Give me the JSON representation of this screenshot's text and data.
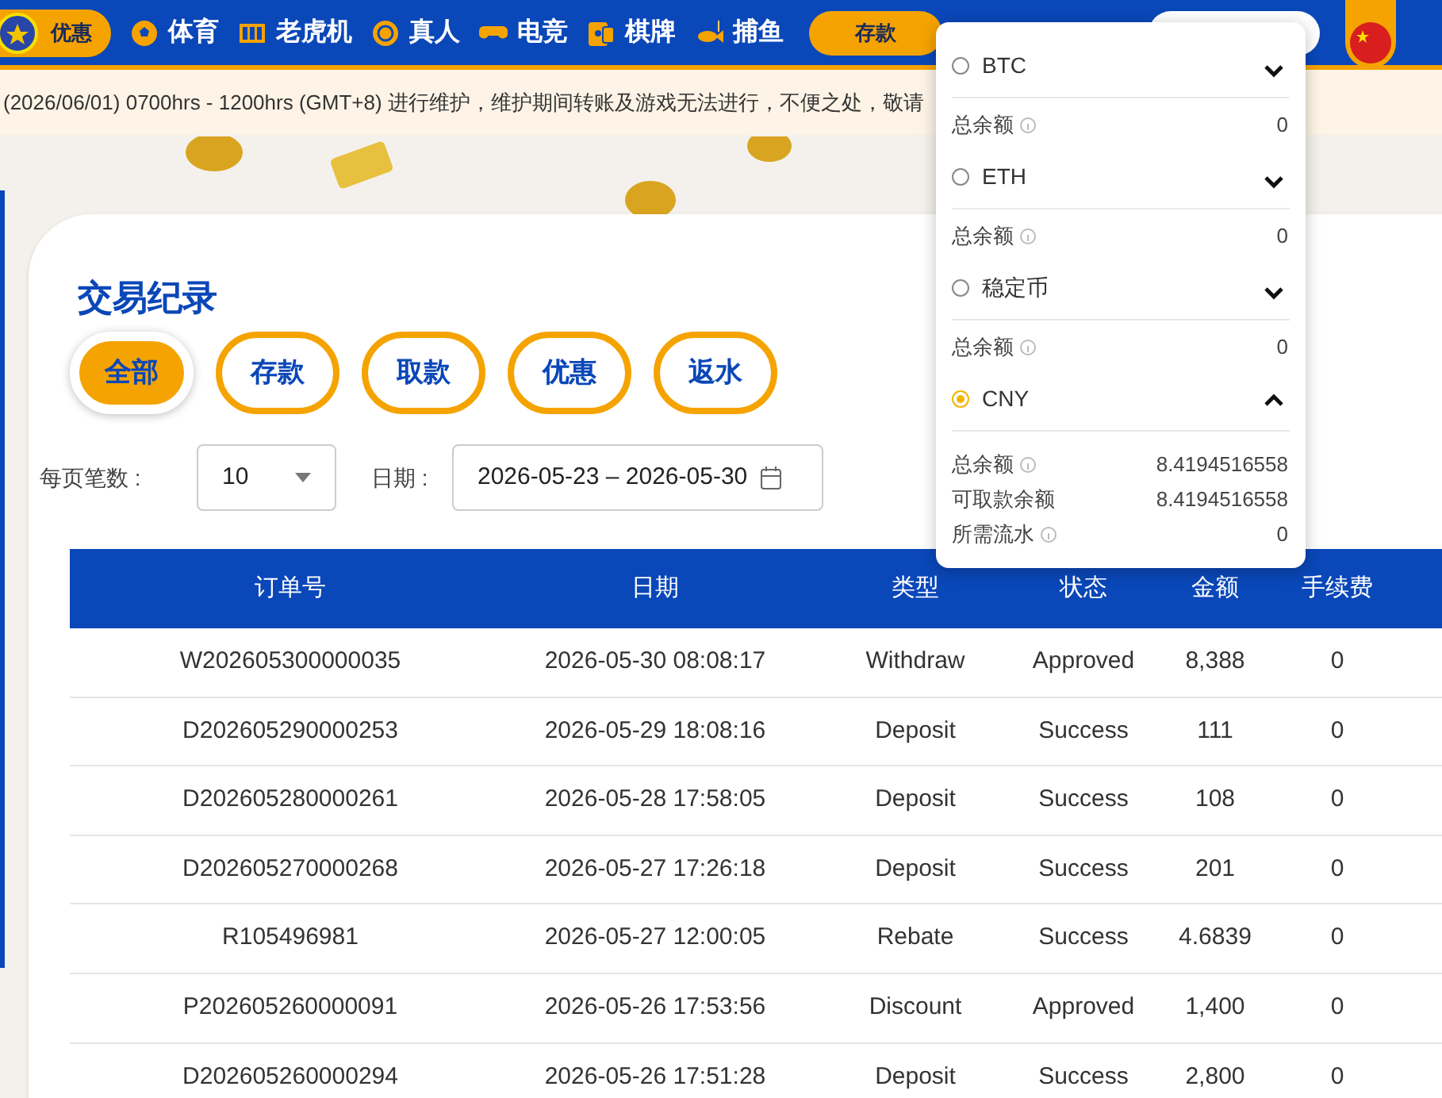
{
  "header": {
    "promo_label": "优惠",
    "nav": [
      {
        "label": "体育",
        "kind": "ball"
      },
      {
        "label": "老虎机",
        "kind": "slot"
      },
      {
        "label": "真人",
        "kind": "chip"
      },
      {
        "label": "电竞",
        "kind": "gamepad"
      },
      {
        "label": "棋牌",
        "kind": "cards"
      },
      {
        "label": "捕鱼",
        "kind": "fish"
      }
    ],
    "deposit_button": "存款"
  },
  "notice": "(2026/06/01)  0700hrs - 1200hrs (GMT+8) 进行维护，维护期间转账及游戏无法进行，不便之处，敬请",
  "page": {
    "title": "交易纪录",
    "filters": [
      {
        "label": "全部",
        "selected": true
      },
      {
        "label": "存款",
        "selected": false
      },
      {
        "label": "取款",
        "selected": false
      },
      {
        "label": "优惠",
        "selected": false
      },
      {
        "label": "返水",
        "selected": false
      }
    ],
    "page_size_label": "每页笔数 :",
    "page_size": "10",
    "date_label": "日期 :",
    "date_from": "2026-05-23",
    "date_separator": "–",
    "date_to": "2026-05-30"
  },
  "table": {
    "columns": [
      "订单号",
      "日期",
      "类型",
      "状态",
      "金额",
      "手续费"
    ],
    "rows": [
      [
        "W202605300000035",
        "2026-05-30 08:08:17",
        "Withdraw",
        "Approved",
        "8,388",
        "0"
      ],
      [
        "D202605290000253",
        "2026-05-29 18:08:16",
        "Deposit",
        "Success",
        "111",
        "0"
      ],
      [
        "D202605280000261",
        "2026-05-28 17:58:05",
        "Deposit",
        "Success",
        "108",
        "0"
      ],
      [
        "D202605270000268",
        "2026-05-27 17:26:18",
        "Deposit",
        "Success",
        "201",
        "0"
      ],
      [
        "R105496981",
        "2026-05-27 12:00:05",
        "Rebate",
        "Success",
        "4.6839",
        "0"
      ],
      [
        "P202605260000091",
        "2026-05-26 17:53:56",
        "Discount",
        "Approved",
        "1,400",
        "0"
      ],
      [
        "D202605260000294",
        "2026-05-26 17:51:28",
        "Deposit",
        "Success",
        "2,800",
        "0"
      ]
    ]
  },
  "wallet_dropdown": {
    "currencies": [
      {
        "name": "BTC",
        "selected": false,
        "expanded": false,
        "balances": [
          {
            "label": "总余额",
            "info": true,
            "value": "0"
          }
        ]
      },
      {
        "name": "ETH",
        "selected": false,
        "expanded": false,
        "balances": [
          {
            "label": "总余额",
            "info": true,
            "value": "0"
          }
        ]
      },
      {
        "name": "稳定币",
        "selected": false,
        "expanded": false,
        "balances": [
          {
            "label": "总余额",
            "info": true,
            "value": "0"
          }
        ]
      },
      {
        "name": "CNY",
        "selected": true,
        "expanded": true,
        "balances": [
          {
            "label": "总余额",
            "info": true,
            "value": "8.4194516558"
          },
          {
            "label": "可取款余额",
            "info": false,
            "value": "8.4194516558"
          },
          {
            "label": "所需流水",
            "info": true,
            "value": "0"
          }
        ]
      }
    ]
  }
}
